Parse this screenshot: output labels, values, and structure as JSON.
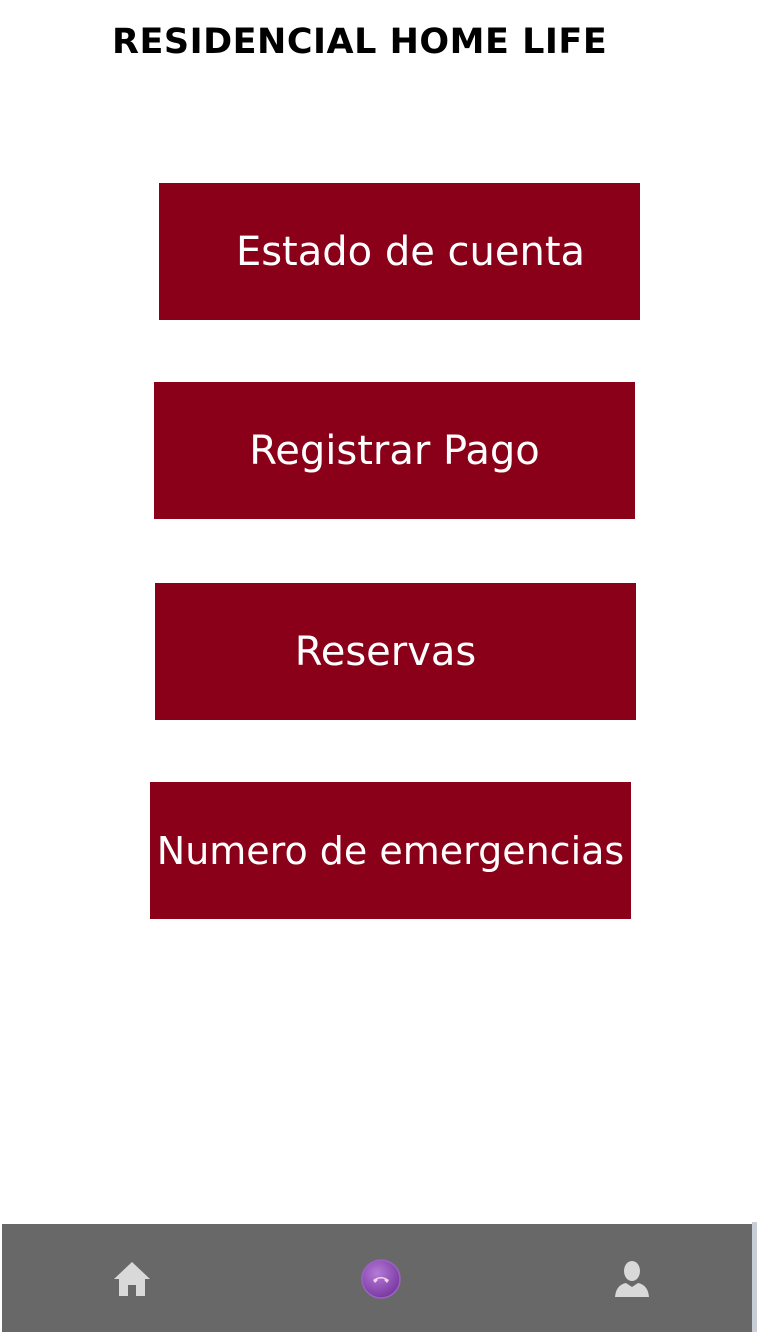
{
  "header": {
    "title": "RESIDENCIAL HOME LIFE"
  },
  "menu": {
    "items": [
      {
        "label": "Estado de cuenta"
      },
      {
        "label": "Registrar Pago"
      },
      {
        "label": "Reservas"
      },
      {
        "label": "Numero de emergencias"
      }
    ]
  },
  "bottom_nav": {
    "items": [
      {
        "icon": "home-icon"
      },
      {
        "icon": "phone-icon"
      },
      {
        "icon": "user-icon"
      }
    ]
  },
  "colors": {
    "accent": "#8a0018",
    "nav_bar": "#686868",
    "call_button": "#8e4bb0"
  }
}
